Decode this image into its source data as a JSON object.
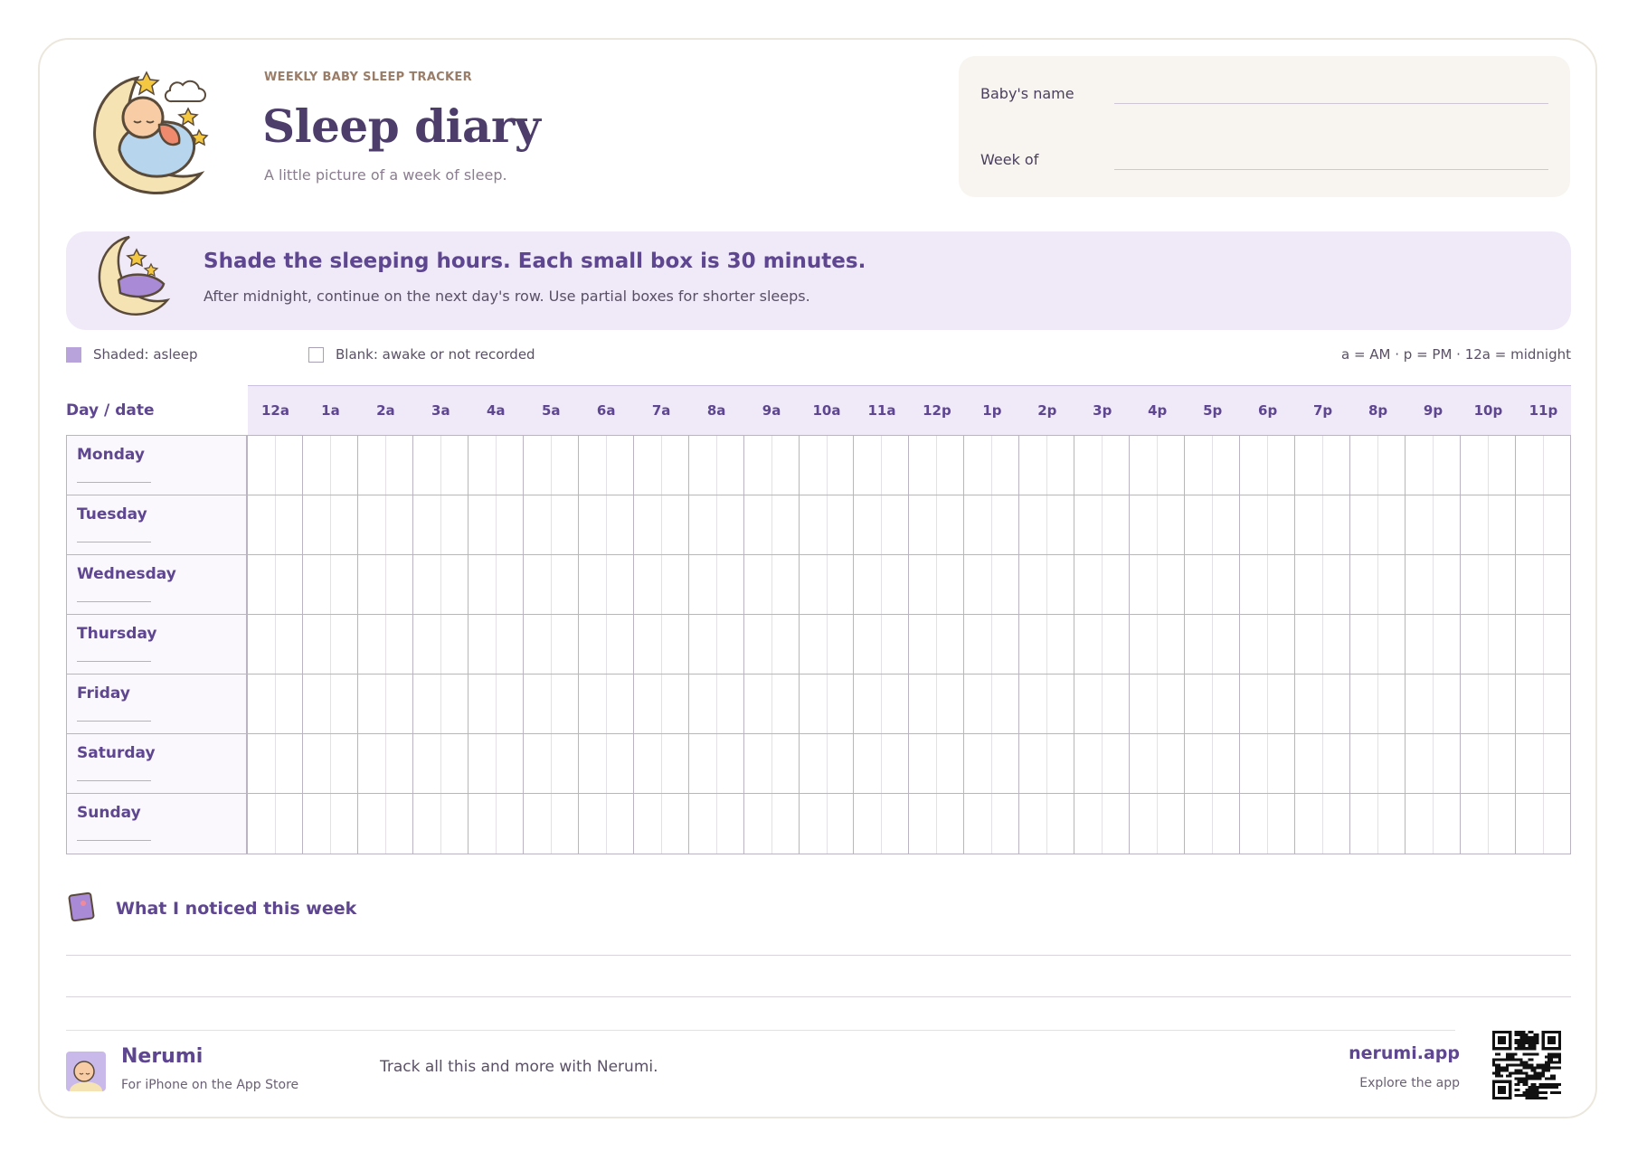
{
  "header": {
    "eyebrow": "WEEKLY BABY SLEEP TRACKER",
    "title": "Sleep diary",
    "subtitle": "A little picture of a week of sleep."
  },
  "name_card": {
    "baby_name_label": "Baby's name",
    "week_of_label": "Week of"
  },
  "banner": {
    "title": "Shade the sleeping hours. Each small box is 30 minutes.",
    "text": "After midnight, continue on the next day's row. Use partial boxes for shorter sleeps."
  },
  "legend": {
    "shaded_label": "Shaded: asleep",
    "blank_label": "Blank: awake or not recorded",
    "note": "a = AM · p = PM · 12a = midnight",
    "shaded_color": "#b9a3db"
  },
  "grid": {
    "day_header": "Day / date",
    "hours": [
      "12a",
      "1a",
      "2a",
      "3a",
      "4a",
      "5a",
      "6a",
      "7a",
      "8a",
      "9a",
      "10a",
      "11a",
      "12p",
      "1p",
      "2p",
      "3p",
      "4p",
      "5p",
      "6p",
      "7p",
      "8p",
      "9p",
      "10p",
      "11p"
    ],
    "days": [
      "Monday",
      "Tuesday",
      "Wednesday",
      "Thursday",
      "Friday",
      "Saturday",
      "Sunday"
    ]
  },
  "notes": {
    "title": "What I noticed this week"
  },
  "footer": {
    "brand": "Nerumi",
    "brand_sub": "For iPhone on the App Store",
    "tagline": "Track all this and more with Nerumi.",
    "site": "nerumi.app",
    "site_sub": "Explore the app"
  },
  "icons": {
    "logo": "sleeping-baby-on-moon-icon",
    "banner": "moon-with-pillow-icon",
    "notes": "notebook-icon",
    "footer_avatar": "baby-avatar-icon",
    "qr": "qr-code-icon"
  },
  "colors": {
    "accent": "#5e4690",
    "banner_bg": "#efe9f8",
    "card_bg": "#f8f5f0"
  }
}
